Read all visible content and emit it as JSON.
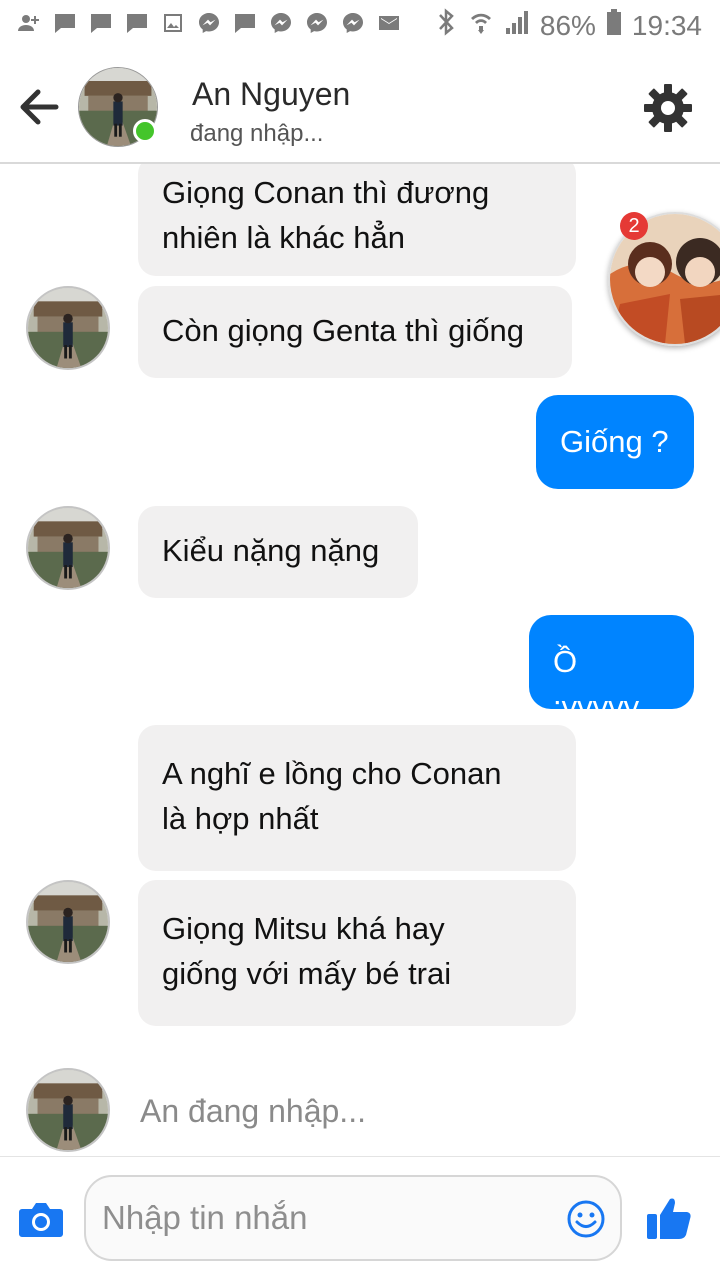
{
  "status_bar": {
    "notification_icons": [
      "add-friend-icon",
      "message-icon",
      "message-icon",
      "message-icon",
      "image-icon",
      "messenger-icon",
      "message-icon",
      "messenger-icon",
      "messenger-icon",
      "messenger-icon",
      "mail-icon"
    ],
    "battery": "86%",
    "time": "19:34"
  },
  "header": {
    "contact_name": "An Nguyen",
    "contact_status": "đang nhập...",
    "online": true
  },
  "messages": [
    {
      "side": "incoming",
      "lines": [
        "Giọng Conan thì đương",
        "nhiên là khác hẳn"
      ]
    },
    {
      "side": "incoming",
      "lines": [
        "Còn giọng Genta thì giống"
      ]
    },
    {
      "side": "outgoing",
      "lines": [
        "Giống ?"
      ]
    },
    {
      "side": "incoming",
      "lines": [
        "Kiểu nặng nặng"
      ]
    },
    {
      "side": "outgoing",
      "lines": [
        "Ồ :vvvvv"
      ]
    },
    {
      "side": "incoming",
      "lines": [
        "A nghĩ e lồng cho Conan",
        "là hợp nhất"
      ]
    },
    {
      "side": "incoming",
      "lines": [
        "Giọng Mitsu khá hay",
        "giống với mấy bé trai"
      ]
    }
  ],
  "typing_indicator": "An đang nhập...",
  "chat_head": {
    "badge": "2"
  },
  "composer": {
    "placeholder": "Nhập tin nhắn"
  },
  "colors": {
    "accent": "#0084ff",
    "incoming_bubble": "#f1f0f0",
    "online": "#44c52b"
  }
}
